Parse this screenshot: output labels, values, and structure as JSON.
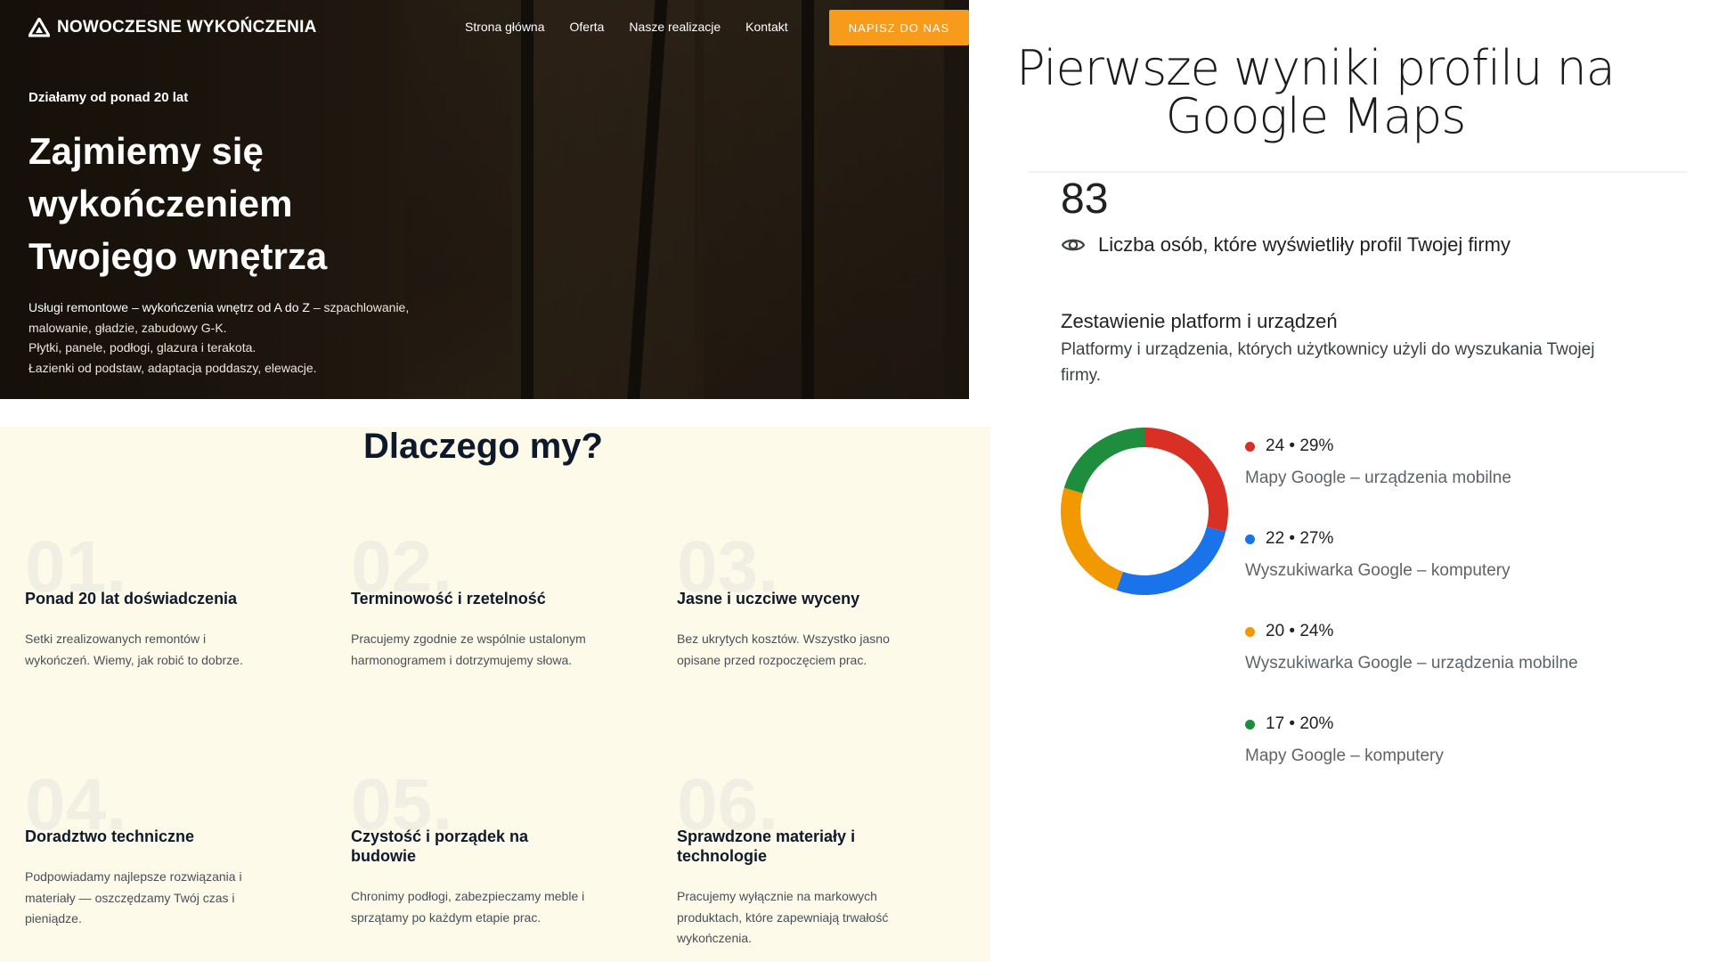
{
  "hero": {
    "logo_text": "NOWOCZESNE WYKOŃCZENIA",
    "nav": [
      "Strona główna",
      "Oferta",
      "Nasze realizacje",
      "Kontakt"
    ],
    "cta": "NAPISZ DO NAS",
    "kicker": "Działamy od ponad 20 lat",
    "title_lines": [
      "Zajmiemy się",
      "wykończeniem",
      "Twojego wnętrza"
    ],
    "desc_lead": "Usługi remontowe – wykończenia wnętrz od A do Z",
    "desc_lead_rest": " – szpachlowanie,",
    "desc_lines": [
      "malowanie, gładzie, zabudowy G-K.",
      "Płytki, panele, podłogi, glazura i terakota.",
      "Łazienki od podstaw, adaptacja poddaszy, elewacje."
    ]
  },
  "why": {
    "title": "Dlaczego my?",
    "features": [
      {
        "num": "01.",
        "title": "Ponad 20 lat doświadczenia",
        "desc": [
          "Setki zrealizowanych remontów i",
          "wykończeń. Wiemy, jak robić to dobrze."
        ]
      },
      {
        "num": "02.",
        "title": "Terminowość i rzetelność",
        "desc": [
          "Pracujemy zgodnie ze wspólnie ustalonym",
          "harmonogramem i dotrzymujemy słowa."
        ]
      },
      {
        "num": "03.",
        "title": "Jasne i uczciwe wyceny",
        "desc": [
          "Bez ukrytych kosztów. Wszystko jasno",
          "opisane przed rozpoczęciem prac."
        ]
      },
      {
        "num": "04.",
        "title": "Doradztwo techniczne",
        "desc": [
          "Podpowiadamy najlepsze rozwiązania i",
          "materiały — oszczędzamy Twój czas i",
          "pieniądze."
        ]
      },
      {
        "num": "05.",
        "title_lines": [
          "Czystość i porządek na",
          "budowie"
        ],
        "desc": [
          "Chronimy podłogi, zabezpieczamy meble i",
          "sprzątamy po każdym etapie prac."
        ]
      },
      {
        "num": "06.",
        "title_lines": [
          "Sprawdzone materiały i",
          "technologie"
        ],
        "desc": [
          "Pracujemy wyłącznie na markowych",
          "produktach, które zapewniają trwałość",
          "wykończenia."
        ]
      }
    ]
  },
  "gmaps": {
    "title_lines": [
      "Pierwsze wyniki profilu na",
      "Google Maps"
    ],
    "views_value": "83",
    "views_label": "Liczba osób, które wyświetliły profil Twojej firmy",
    "section_title": "Zestawienie platform i urządzeń",
    "section_desc_lines": [
      "Platformy i urządzenia, których użytkownicy użyli do wyszukania Twojej",
      "firmy."
    ],
    "legend": [
      {
        "value_text": "24 • 29%",
        "label": "Mapy Google – urządzenia mobilne",
        "color": "#d93025"
      },
      {
        "value_text": "22 • 27%",
        "label": "Wyszukiwarka Google – komputery",
        "color": "#1a73e8"
      },
      {
        "value_text": "20 • 24%",
        "label": "Wyszukiwarka Google – urządzenia mobilne",
        "color": "#f29900"
      },
      {
        "value_text": "17 • 20%",
        "label": "Mapy Google – komputery",
        "color": "#1e8e3e"
      }
    ]
  },
  "chart_data": {
    "type": "pie",
    "categories": [
      "Mapy Google – urządzenia mobilne",
      "Wyszukiwarka Google – komputery",
      "Wyszukiwarka Google – urządzenia mobilne",
      "Mapy Google – komputery"
    ],
    "values": [
      24,
      22,
      20,
      17
    ],
    "percentages": [
      29,
      27,
      24,
      20
    ],
    "colors": [
      "#d93025",
      "#1a73e8",
      "#f29900",
      "#1e8e3e"
    ]
  }
}
